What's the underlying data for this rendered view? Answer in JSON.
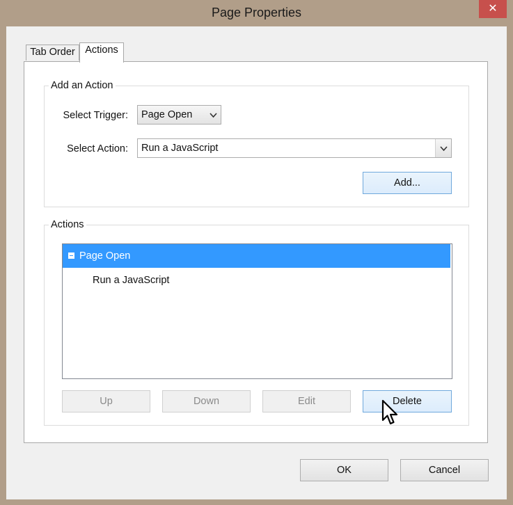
{
  "window": {
    "title": "Page Properties",
    "close_label": "✕"
  },
  "tabs": [
    {
      "label": "Tab Order",
      "selected": false
    },
    {
      "label": "Actions",
      "selected": true
    }
  ],
  "add_action": {
    "legend": "Add an Action",
    "trigger_label": "Select Trigger:",
    "trigger_value": "Page Open",
    "action_label": "Select Action:",
    "action_value": "Run a JavaScript",
    "add_button": "Add..."
  },
  "actions": {
    "legend": "Actions",
    "tree": {
      "parent": "Page Open",
      "child": "Run a JavaScript"
    },
    "buttons": {
      "up": "Up",
      "down": "Down",
      "edit": "Edit",
      "delete": "Delete"
    }
  },
  "footer": {
    "ok": "OK",
    "cancel": "Cancel"
  },
  "colors": {
    "selection": "#3399ff",
    "window_frame": "#b19e89",
    "close": "#c7504c"
  }
}
